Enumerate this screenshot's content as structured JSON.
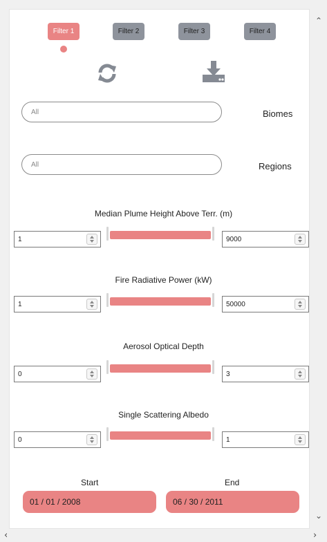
{
  "tabs": [
    {
      "label": "Filter 1",
      "active": true
    },
    {
      "label": "Filter 2",
      "active": false
    },
    {
      "label": "Filter 3",
      "active": false
    },
    {
      "label": "Filter 4",
      "active": false
    }
  ],
  "toolbar": {
    "refresh_icon": "refresh-icon",
    "download_icon": "download-icon"
  },
  "biomes": {
    "value": "All",
    "label": "Biomes"
  },
  "regions": {
    "value": "All",
    "label": "Regions"
  },
  "filters": [
    {
      "title": "Median Plume Height Above Terr. (m)",
      "min": "1",
      "max": "9000"
    },
    {
      "title": "Fire Radiative Power (kW)",
      "min": "1",
      "max": "50000"
    },
    {
      "title": "Aerosol Optical Depth",
      "min": "0",
      "max": "3"
    },
    {
      "title": "Single Scattering Albedo",
      "min": "0",
      "max": "1"
    }
  ],
  "dates": {
    "start_label": "Start",
    "start_value": "01 / 01 / 2008",
    "end_label": "End",
    "end_value": "06 / 30 / 2011"
  },
  "colors": {
    "accent": "#e98484",
    "inactive_tab": "#8e939c"
  }
}
